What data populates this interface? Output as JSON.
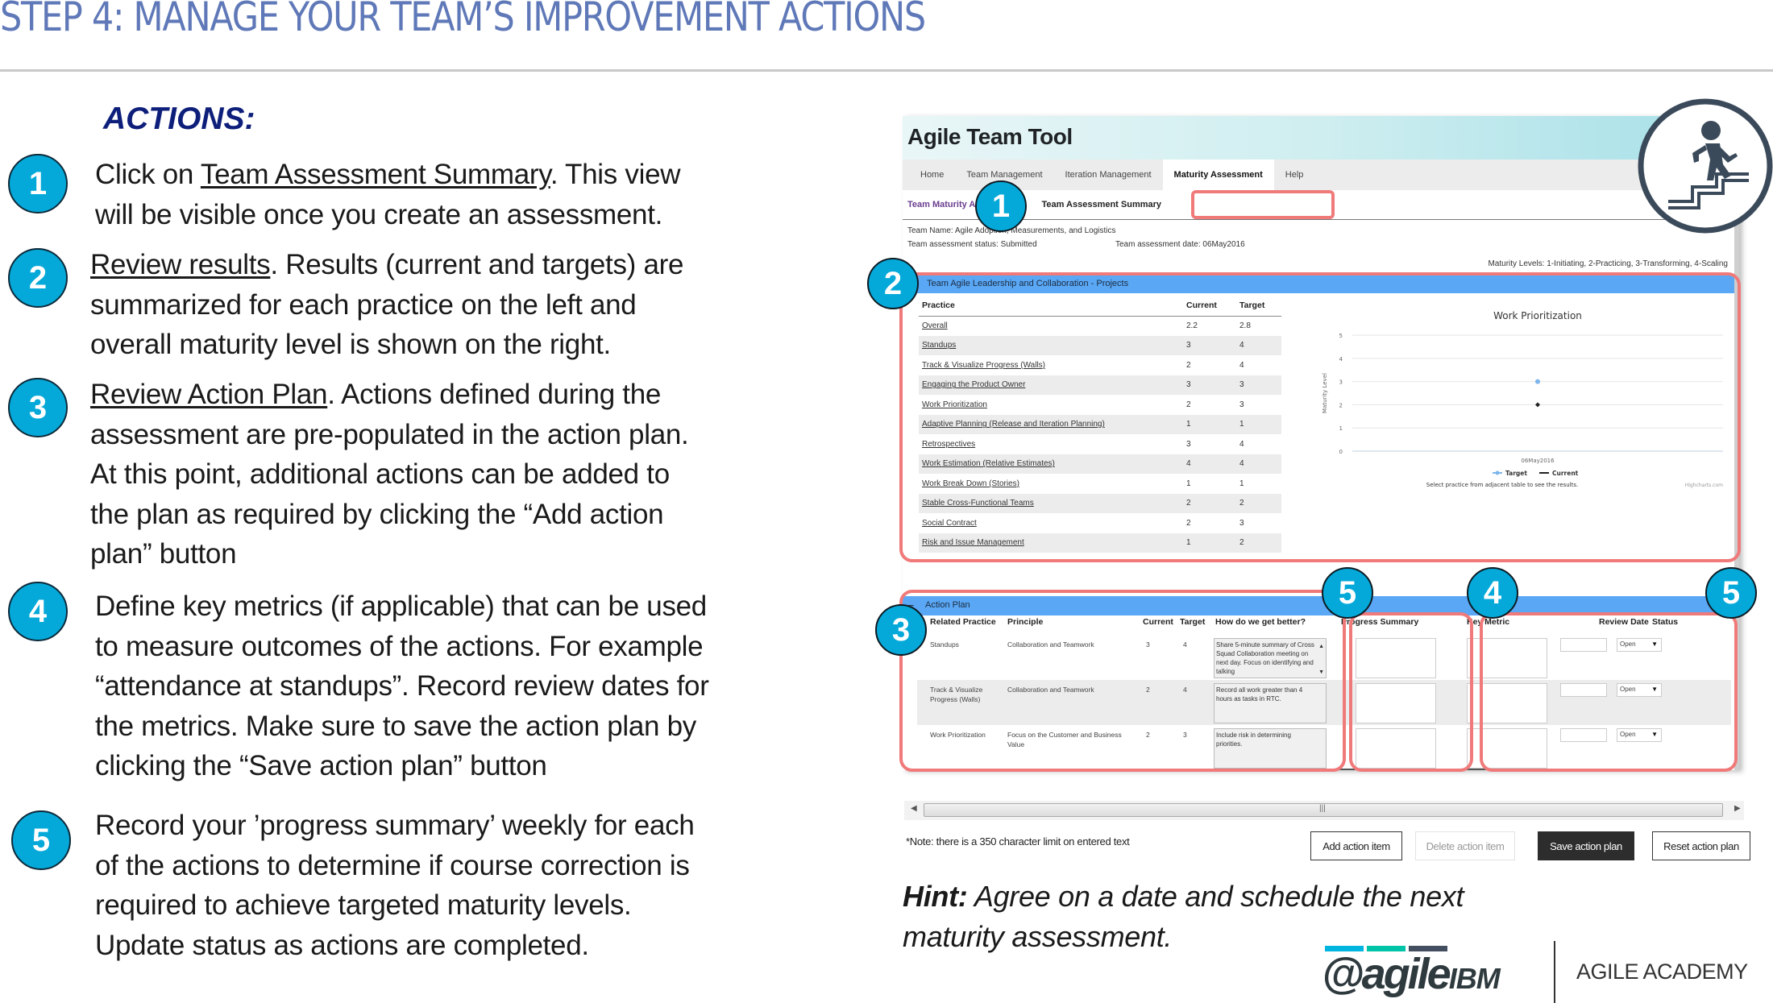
{
  "slide": {
    "title": "STEP 4: MANAGE YOUR TEAM’S IMPROVEMENT ACTIONS",
    "actions_heading": "ACTIONS:",
    "accent_color": "#04a9d9",
    "title_color": "#5f78b8"
  },
  "steps": [
    {
      "number": "1",
      "link": "Team Assessment Summary",
      "lines": [
        "Click on ",
        ". This view",
        "will be visible once you create an assessment."
      ]
    },
    {
      "number": "2",
      "link": "Review results",
      "lines": [
        ". Results (current and targets) are",
        "summarized for each practice on the left and",
        "overall maturity level is shown on the right."
      ]
    },
    {
      "number": "3",
      "link": "Review Action Plan",
      "lines": [
        ". Actions defined during the",
        "assessment are pre-populated in the action plan.",
        "At this point, additional actions can be added to",
        "the plan as required by clicking the “Add action",
        "plan” button"
      ]
    },
    {
      "number": "4",
      "lines": [
        "Define key metrics (if applicable) that can be used",
        "to measure outcomes of the actions. For example",
        "“attendance at standups”. Record review dates for",
        "the metrics. Make sure to save the action plan by",
        "clicking the “Save action plan” button"
      ]
    },
    {
      "number": "5",
      "lines": [
        "Record your ’progress summary’ weekly for each",
        "of the actions to determine if course correction is",
        "required to achieve targeted maturity levels.",
        "Update status as actions are completed."
      ]
    }
  ],
  "app": {
    "title": "Agile Team Tool",
    "nav": [
      "Home",
      "Team Management",
      "Iteration Management",
      "Maturity Assessment",
      "Help"
    ],
    "nav_active": "Maturity Assessment",
    "breadcrumb": [
      "Team Maturity As",
      "Team Assessment Summary"
    ],
    "team_name": "Team Name: Agile Adoption, Measurements, and Logistics",
    "status": "Team assessment status: Submitted",
    "date": "Team assessment date: 06May2016",
    "levels": "Maturity Levels: 1-Initiating, 2-Practicing, 3-Transforming, 4-Scaling",
    "results_section": "Team Agile Leadership and Collaboration - Projects",
    "practice_headers": [
      "Practice",
      "Current",
      "Target"
    ],
    "practices": [
      {
        "name": "Overall",
        "current": "2.2",
        "target": "2.8"
      },
      {
        "name": "Standups",
        "current": "3",
        "target": "4"
      },
      {
        "name": "Track & Visualize Progress (Walls)",
        "current": "2",
        "target": "4"
      },
      {
        "name": "Engaging the Product Owner",
        "current": "3",
        "target": "3"
      },
      {
        "name": "Work Prioritization",
        "current": "2",
        "target": "3"
      },
      {
        "name": "Adaptive Planning (Release and Iteration Planning)",
        "current": "1",
        "target": "1"
      },
      {
        "name": "Retrospectives",
        "current": "3",
        "target": "4"
      },
      {
        "name": "Work Estimation (Relative Estimates)",
        "current": "4",
        "target": "4"
      },
      {
        "name": "Work Break Down (Stories)",
        "current": "1",
        "target": "1"
      },
      {
        "name": "Stable Cross-Functional Teams",
        "current": "2",
        "target": "2"
      },
      {
        "name": "Social Contract",
        "current": "2",
        "target": "3"
      },
      {
        "name": "Risk and Issue Management",
        "current": "1",
        "target": "2"
      }
    ],
    "action_plan": {
      "title": "Action Plan",
      "collapse_icon": "minus",
      "headers": [
        "Related Practice",
        "Principle",
        "Current",
        "Target",
        "How do we get better?",
        "Progress Summary",
        "Key Metric",
        "Review Date",
        "Status"
      ],
      "rows": [
        {
          "practice": "Standups",
          "principle": "Collaboration and Teamwork",
          "current": "3",
          "target": "4",
          "how": "Share 5-minute summary of Cross Squad Collaboration meeting on next day.\nFocus on identifying and talking",
          "progress": "",
          "metric": "",
          "review_date": "",
          "status": "Open"
        },
        {
          "practice": "Track & Visualize Progress (Walls)",
          "principle": "Collaboration and Teamwork",
          "current": "2",
          "target": "4",
          "how": "Record all work greater than 4 hours as tasks in RTC.",
          "progress": "",
          "metric": "",
          "review_date": "",
          "status": "Open"
        },
        {
          "practice": "Work Prioritization",
          "principle": "Focus on the Customer and Business Value",
          "current": "2",
          "target": "3",
          "how": "Include risk in determining priorities.",
          "progress": "",
          "metric": "",
          "review_date": "",
          "status": "Open"
        }
      ]
    },
    "scrollbar_grip": "|||",
    "note": "*Note: there is a 350 character limit on entered text",
    "buttons": {
      "add": "Add action item",
      "delete": "Delete action item",
      "save": "Save action plan",
      "reset": "Reset action plan"
    },
    "callouts": [
      "1",
      "2",
      "3",
      "5",
      "4",
      "5"
    ]
  },
  "chart_data": {
    "type": "scatter",
    "title": "Work Prioritization",
    "xlabel": "",
    "ylabel": "Maturity Level",
    "categories": [
      "06May2016"
    ],
    "ylim": [
      0,
      5
    ],
    "yticks": [
      0,
      1,
      2,
      3,
      4,
      5
    ],
    "grid": true,
    "series": [
      {
        "name": "Target",
        "values": [
          3
        ],
        "color": "#7cb5ec"
      },
      {
        "name": "Current",
        "values": [
          2
        ],
        "color": "#222222"
      }
    ],
    "legend": "bottom-center",
    "caption": "Select practice from adjacent table to see the results.",
    "credit": "Highcharts.com"
  },
  "hint": {
    "label": "Hint:",
    "lines": [
      " Agree on a date and schedule the next",
      "maturity assessment."
    ]
  },
  "logo": {
    "at": "@agile",
    "ibm": "IBM",
    "academy": "AGILE ACADEMY",
    "bar_colors": [
      "#00b4e0",
      "#00c4a7",
      "#434e60"
    ]
  }
}
